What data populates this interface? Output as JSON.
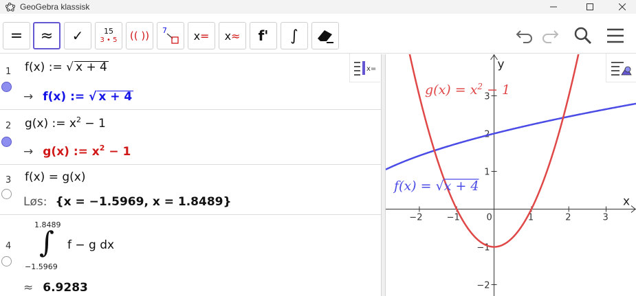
{
  "window": {
    "title": "GeoGebra klassisk"
  },
  "toolbar": {
    "tools": [
      {
        "name": "evaluate-tool",
        "label": "="
      },
      {
        "name": "numeric-tool",
        "label": "≈"
      },
      {
        "name": "keep-input-tool",
        "label": "✓"
      },
      {
        "name": "factor-tool",
        "top": "15",
        "bottom": "3 • 5"
      },
      {
        "name": "expand-tool",
        "label": "(( ))"
      },
      {
        "name": "substitute-tool",
        "label": "7"
      },
      {
        "name": "solve-tool",
        "label": "x="
      },
      {
        "name": "solve-numerically-tool",
        "label": "x≈"
      },
      {
        "name": "derivative-tool",
        "label": "f'"
      },
      {
        "name": "integral-tool",
        "label": "∫"
      },
      {
        "name": "delete-tool",
        "label": ""
      }
    ],
    "selected": "numeric-tool"
  },
  "cas": {
    "rows": [
      {
        "num": "1",
        "input": "f(x) := ",
        "input_sqrt": "x + 4",
        "output_prefix": "→",
        "output": "f(x) := ",
        "output_sqrt": "x + 4",
        "output_color": "#1414e6",
        "visible": true
      },
      {
        "num": "2",
        "input": "g(x) := x",
        "input_exp": "2",
        "input_tail": " − 1",
        "output_prefix": "→",
        "output": "g(x) := x",
        "output_exp": "2",
        "output_tail": " − 1",
        "output_color": "#d11818",
        "visible": true
      },
      {
        "num": "3",
        "input": "f(x)  =  g(x)",
        "output_prefix": "Løs:",
        "output": "{x = −1.5969, x = 1.8489}",
        "output_color": "#111111",
        "visible": false
      },
      {
        "num": "4",
        "upper": "1.8489",
        "lower": "−1.5969",
        "integrand": "f − g dx",
        "output_prefix": "≈",
        "output": "6.9283",
        "output_color": "#111111",
        "visible": false
      }
    ]
  },
  "graphics": {
    "x_axis_label": "x",
    "y_axis_label": "y",
    "x_ticks": [
      "−2",
      "−1",
      "0",
      "1",
      "2",
      "3"
    ],
    "y_ticks": [
      "3",
      "2",
      "1",
      "−1",
      "−2"
    ],
    "g_label": "g(x)  =  x",
    "g_label_exp": "2",
    "g_label_tail": " − 1",
    "f_label": "f(x)  =  ",
    "f_label_sqrt": "x + 4",
    "f_color": "#4b4be6",
    "g_color": "#e04848"
  },
  "chart_data": {
    "type": "line",
    "series": [
      {
        "name": "f(x) = √(x+4)",
        "x": [
          -2.8,
          -2,
          -1.5969,
          -1,
          0,
          1,
          1.8489,
          2,
          3,
          3.8
        ],
        "y": [
          1.095,
          1.414,
          1.55,
          1.732,
          2,
          2.236,
          2.419,
          2.449,
          2.646,
          2.793
        ]
      },
      {
        "name": "g(x) = x² − 1",
        "x": [
          -2.2,
          -2,
          -1.5969,
          -1,
          0,
          1,
          1.8489,
          2,
          2.2
        ],
        "y": [
          3.84,
          3,
          1.55,
          0,
          -1,
          0,
          2.419,
          3,
          3.84
        ]
      }
    ],
    "xlim": [
      -2.9,
      3.8
    ],
    "ylim": [
      -2.3,
      4.1
    ],
    "grid": false
  }
}
